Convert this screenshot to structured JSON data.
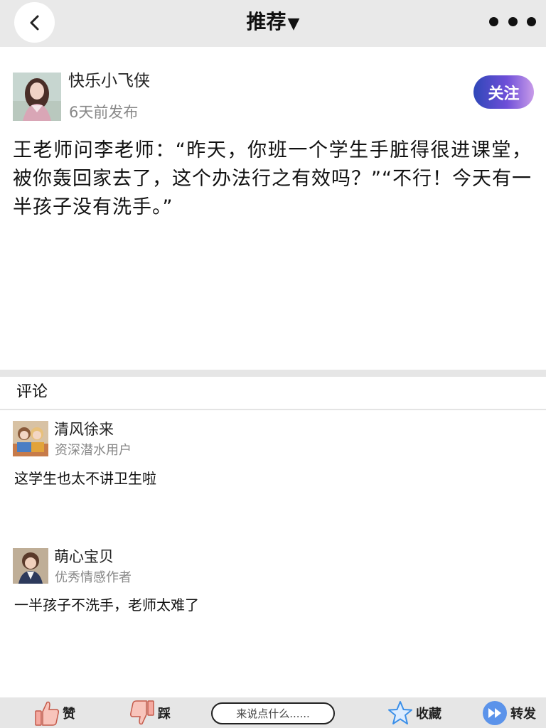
{
  "header": {
    "title": "推荐",
    "dropdown_glyph": "▼",
    "back_icon": "chevron-left-icon",
    "more_icon": "more-dots-icon"
  },
  "post": {
    "author_name": "快乐小飞侠",
    "time_label": "6天前发布",
    "follow_label": "关注",
    "content": "王老师问李老师：“昨天，你班一个学生手脏得很进课堂，被你轰回家去了，这个办法行之有效吗？”“不行！今天有一半孩子没有洗手。”"
  },
  "comments_section": {
    "title": "评论",
    "items": [
      {
        "name": "清风徐来",
        "title": "资深潜水用户",
        "text": "这学生也太不讲卫生啦"
      },
      {
        "name": "萌心宝贝",
        "title": "优秀情感作者",
        "text": "一半孩子不洗手，老师太难了"
      }
    ]
  },
  "bottom_bar": {
    "like_label": "赞",
    "dislike_label": "踩",
    "comment_placeholder": "来说点什么......",
    "favorite_label": "收藏",
    "share_label": "转发"
  },
  "colors": {
    "accent_gradient_start": "#2f47b8",
    "accent_gradient_end": "#c89be9",
    "star_blue": "#3b8fe8",
    "share_blue": "#4a86e8",
    "thumb_pink": "#f4a9a0",
    "topbar_bg": "#e9e9e9"
  }
}
